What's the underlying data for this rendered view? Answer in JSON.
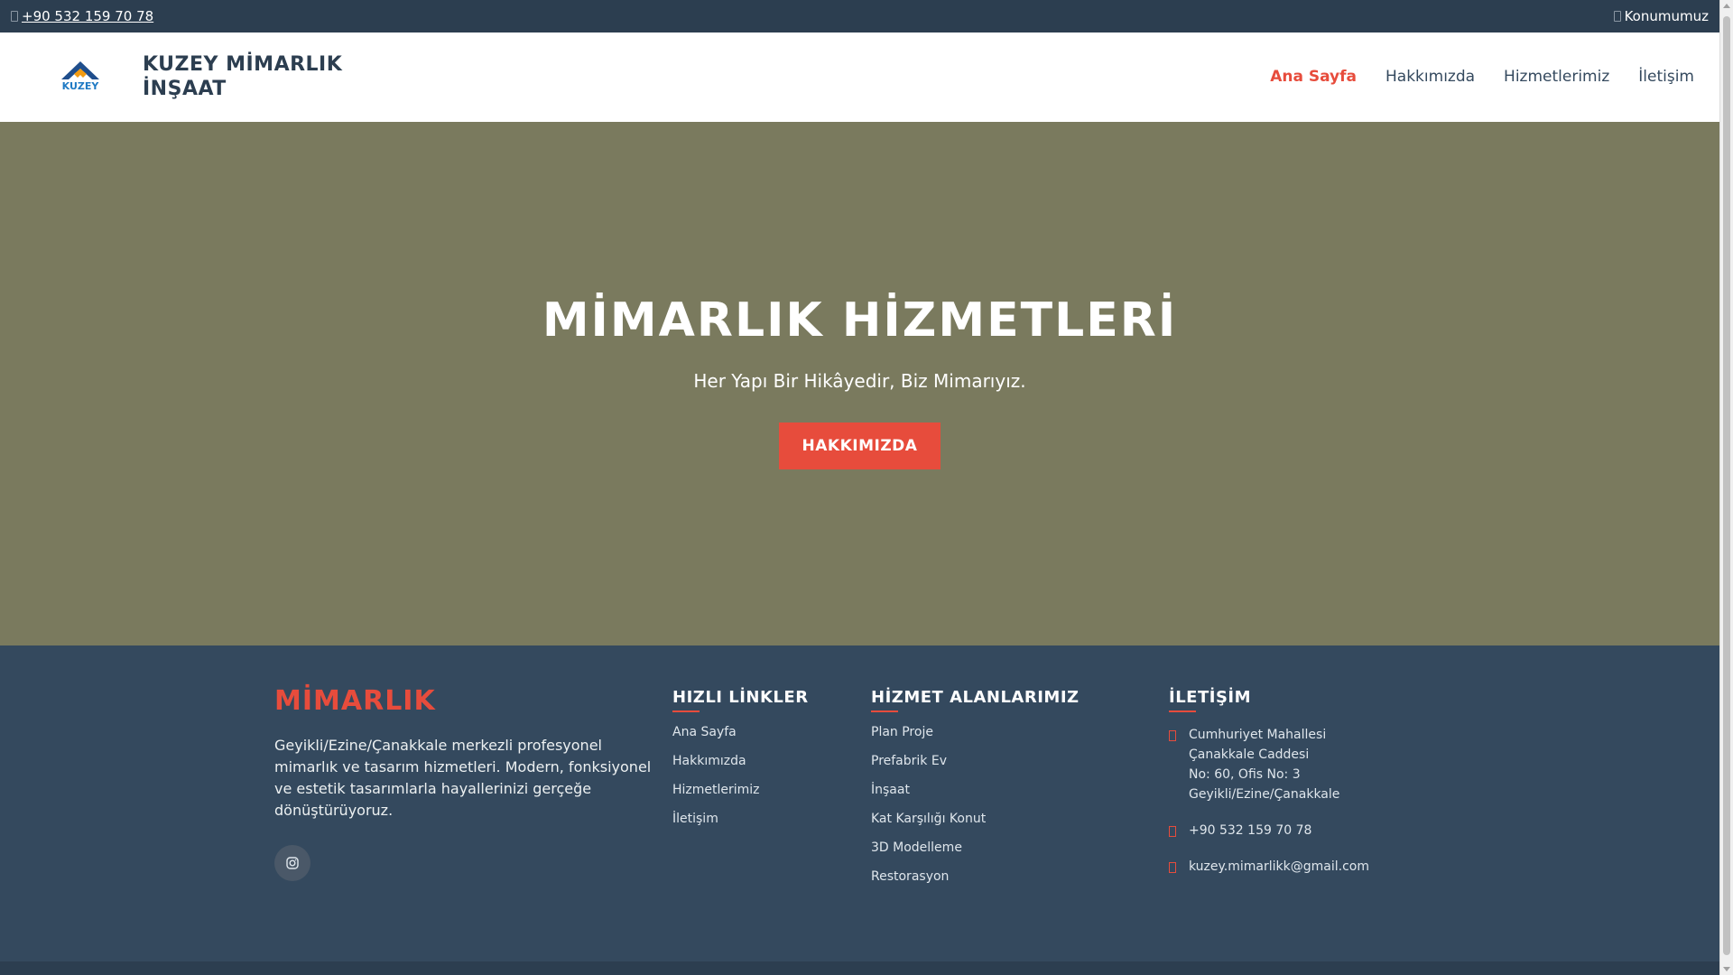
{
  "topbar": {
    "phone": "+90 532 159 70 78",
    "location_link": "Konumumuz"
  },
  "header": {
    "logo_text": "KUZEY",
    "brand_line1": "KUZEY MİMARLIK",
    "brand_line2": "İNŞAAT",
    "nav": [
      "Ana Sayfa",
      "Hakkımızda",
      "Hizmetlerimiz",
      "İletişim"
    ]
  },
  "hero": {
    "title": "MİMARLIK HİZMETLERİ",
    "subtitle": "Her Yapı Bir Hikâyedir, Biz Mimarıyız.",
    "cta_label": "HAKKIMIZDA"
  },
  "footer": {
    "about_title": "MİMARLIK",
    "about_text": "Geyikli/Ezine/Çanakkale merkezli profesyonel mimarlık ve tasarım hizmetleri. Modern, fonksiyonel ve estetik tasarımlarla hayallerinizi gerçeğe dönüştürüyoruz.",
    "social_icon": "instagram-icon",
    "quick_links_title": "HIZLI LİNKLER",
    "quick_links": [
      "Ana Sayfa",
      "Hakkımızda",
      "Hizmetlerimiz",
      "İletişim"
    ],
    "services_title": "HİZMET ALANLARIMIZ",
    "services": [
      "Plan Proje",
      "Prefabrik Ev",
      "İnşaat",
      "Kat Karşılığı Konut",
      "3D Modelleme",
      "Restorasyon"
    ],
    "contact_title": "İLETİŞİM",
    "address_line1": "Cumhuriyet Mahallesi",
    "address_line2": "Çanakkale Caddesi",
    "address_line3": "No: 60, Ofis No: 3",
    "address_line4": "Geyikli/Ezine/Çanakkale",
    "phone": "+90 532 159 70 78",
    "email": "kuzey.mimarlikk@gmail.com"
  },
  "colors": {
    "accent": "#e74c3c",
    "dark": "#2c3e50",
    "footer": "#34495e",
    "hero": "#7a7a5e"
  }
}
